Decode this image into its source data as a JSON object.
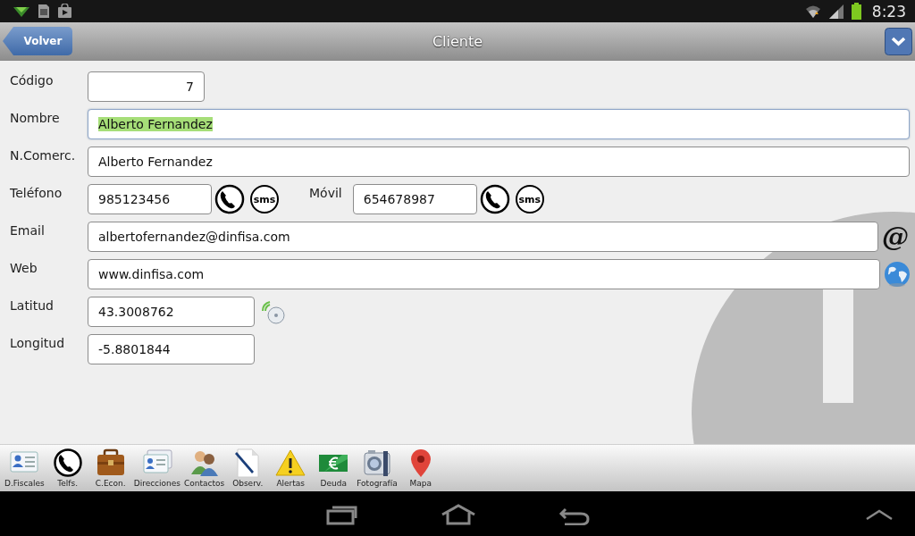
{
  "status_bar": {
    "time": "8:23"
  },
  "header": {
    "back_button": "Volver",
    "title": "Cliente"
  },
  "form": {
    "rows": [
      {
        "kind": "code",
        "label": "Código",
        "value": "7",
        "focused": false
      },
      {
        "kind": "text",
        "label": "Nombre",
        "value": "Alberto Fernandez",
        "focused": true
      },
      {
        "kind": "text",
        "label": "N.Comerc.",
        "value": "Alberto Fernandez",
        "focused": false
      },
      {
        "kind": "phone",
        "label": "Teléfono",
        "value": "985123456",
        "sms": "sms",
        "second_label": "Móvil",
        "second_value": "654678987",
        "second_sms": "sms",
        "focused": false
      },
      {
        "kind": "email",
        "label": "Email",
        "value": "albertofernandez@dinfisa.com",
        "action": "@",
        "focused": false
      },
      {
        "kind": "web",
        "label": "Web",
        "value": "www.dinfisa.com",
        "focused": false
      },
      {
        "kind": "gps",
        "label": "Latitud",
        "value": "43.3008762",
        "focused": false
      },
      {
        "kind": "coord",
        "label": "Longitud",
        "value": "-5.8801844",
        "focused": false
      }
    ]
  },
  "toolbar": [
    {
      "kind": "card",
      "label": "D.Fiscales"
    },
    {
      "kind": "phone",
      "label": "Telfs."
    },
    {
      "kind": "briefcase",
      "label": "C.Econ."
    },
    {
      "kind": "cards",
      "label": "Direcciones"
    },
    {
      "kind": "people",
      "label": "Contactos"
    },
    {
      "kind": "note",
      "label": "Observ."
    },
    {
      "kind": "warning",
      "label": "Alertas"
    },
    {
      "kind": "money",
      "label": "Deuda"
    },
    {
      "kind": "camera",
      "label": "Fotografía"
    },
    {
      "kind": "pin",
      "label": "Mapa"
    }
  ]
}
